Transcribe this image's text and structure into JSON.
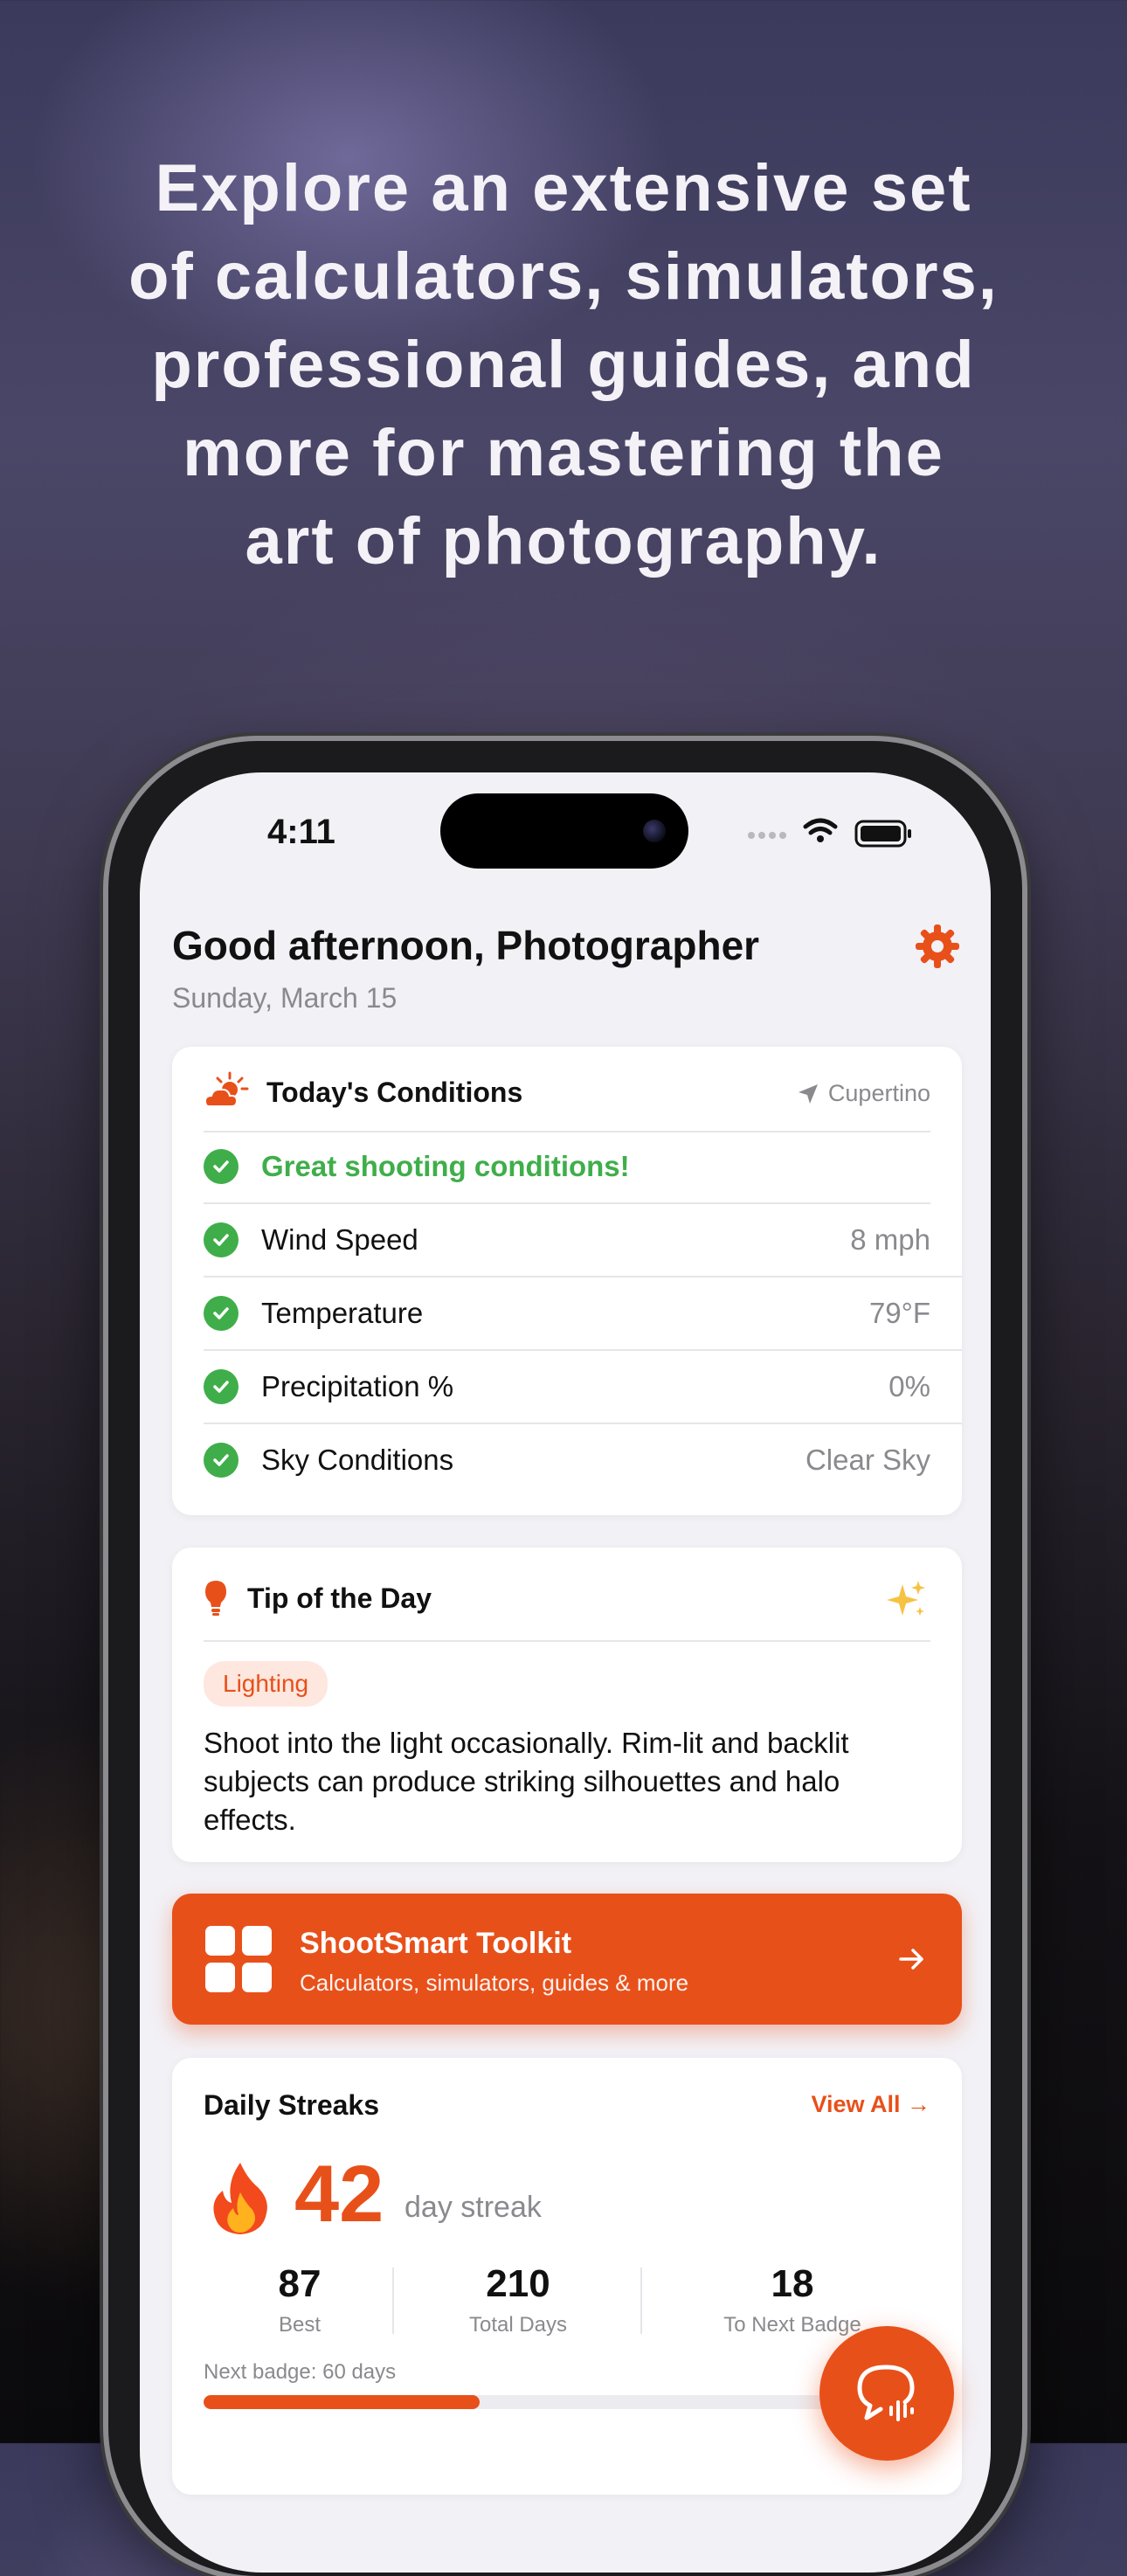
{
  "headline": "Explore an extensive set\nof calculators, simulators,\nprofessional guides, and\nmore for mastering the\nart of photography.",
  "status_bar": {
    "time": "4:11"
  },
  "header": {
    "greeting": "Good afternoon, Photographer",
    "date": "Sunday, March 15"
  },
  "conditions": {
    "title": "Today's Conditions",
    "location": "Cupertino",
    "summary": "Great shooting conditions!",
    "rows": [
      {
        "label": "Wind Speed",
        "value": "8 mph"
      },
      {
        "label": "Temperature",
        "value": "79°F"
      },
      {
        "label": "Precipitation %",
        "value": "0%"
      },
      {
        "label": "Sky Conditions",
        "value": "Clear Sky"
      }
    ]
  },
  "tip": {
    "title": "Tip of the Day",
    "category": "Lighting",
    "text": "Shoot into the light occasionally. Rim-lit and backlit subjects can produce striking silhouettes and halo effects."
  },
  "toolkit": {
    "title": "ShootSmart Toolkit",
    "subtitle": "Calculators, simulators, guides & more"
  },
  "streaks": {
    "title": "Daily Streaks",
    "view_all": "View All →",
    "count": "42",
    "unit": "day streak",
    "stats": [
      {
        "value": "87",
        "label": "Best"
      },
      {
        "value": "210",
        "label": "Total Days"
      },
      {
        "value": "18",
        "label": "To Next Badge"
      }
    ],
    "next_badge": "Next badge: 60 days",
    "progress": 0.38
  },
  "colors": {
    "accent": "#e8501a",
    "success": "#3fae4a"
  },
  "icons": [
    "gear-icon",
    "weather-icon",
    "location-arrow-icon",
    "check-icon",
    "lightbulb-icon",
    "sparkles-icon",
    "grid-icon",
    "arrow-right-icon",
    "fire-icon",
    "chat-wave-icon"
  ]
}
